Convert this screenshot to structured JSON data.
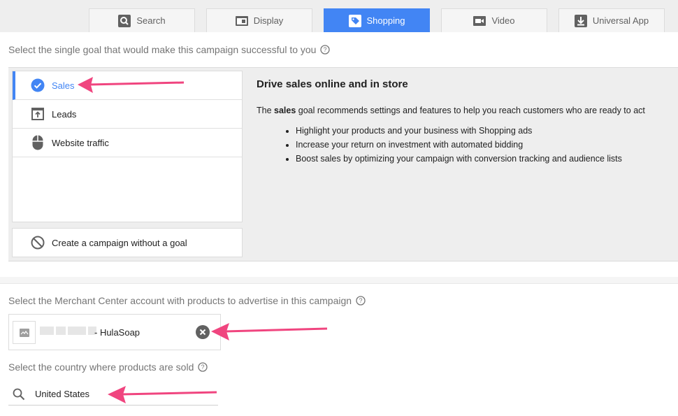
{
  "tabs": [
    {
      "label": "Search",
      "icon": "search-icon",
      "active": false
    },
    {
      "label": "Display",
      "icon": "display-icon",
      "active": false
    },
    {
      "label": "Shopping",
      "icon": "tag-icon",
      "active": true
    },
    {
      "label": "Video",
      "icon": "video-icon",
      "active": false
    },
    {
      "label": "Universal App",
      "icon": "app-download-icon",
      "active": false
    }
  ],
  "goal_section": {
    "prompt": "Select the single goal that would make this campaign successful to you",
    "goals": [
      {
        "label": "Sales",
        "icon": "check-circle-icon",
        "selected": true
      },
      {
        "label": "Leads",
        "icon": "leads-icon",
        "selected": false
      },
      {
        "label": "Website traffic",
        "icon": "mouse-icon",
        "selected": false
      }
    ],
    "no_goal_label": "Create a campaign without a goal"
  },
  "goal_detail": {
    "title": "Drive sales online and in store",
    "desc_prefix": "The ",
    "desc_bold": "sales",
    "desc_suffix": " goal recommends settings and features to help you reach customers who are ready to act",
    "bullets": [
      "Highlight your products and your business with Shopping ads",
      "Increase your return on investment with automated bidding",
      "Boost sales by optimizing your campaign with conversion tracking and audience lists"
    ]
  },
  "merchant": {
    "prompt": "Select the Merchant Center account with products to advertise in this campaign",
    "account_name": "- HulaSoap"
  },
  "country": {
    "prompt": "Select the country where products are sold",
    "value": "United States"
  },
  "colors": {
    "accent": "#4285f4",
    "annotation_arrow": "#f0457f"
  }
}
